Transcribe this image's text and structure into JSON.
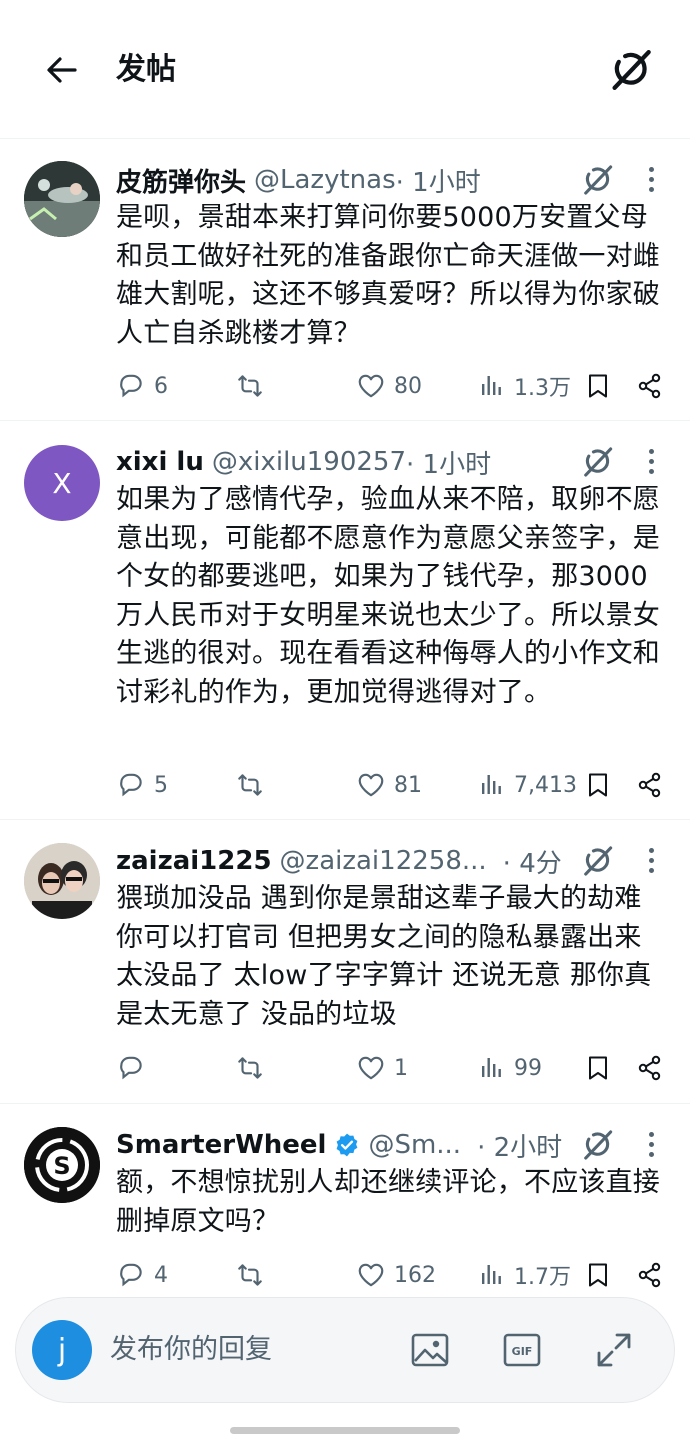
{
  "header": {
    "title": "发帖"
  },
  "icons": {
    "back": "arrow-left-icon",
    "grok": "grok-icon",
    "more": "more-dots-icon",
    "reply": "reply-icon",
    "repost": "repost-icon",
    "like": "heart-icon",
    "views": "views-bar-icon",
    "bookmark": "bookmark-icon",
    "share": "share-icon",
    "image": "image-icon",
    "gif": "gif-icon",
    "expand": "expand-icon",
    "verified": "verified-badge-icon"
  },
  "colors": {
    "text": "#0f1419",
    "secondary": "#536471",
    "accent": "#1d9bf0",
    "avatar_user": "#1d8ee0",
    "avatar_x": "#7e57c2"
  },
  "posts": [
    {
      "name": "皮筋弹你头",
      "handle": "@Lazytnas",
      "time": "· 1小时",
      "text": "是呗，景甜本来打算问你要5000万安置父母和员工做好社死的准备跟你亡命天涯做一对雌雄大割呢，这还不够真爱呀？所以得为你家破人亡自杀跳楼才算？",
      "replies": "6",
      "reposts": "",
      "likes": "80",
      "views": "1.3万"
    },
    {
      "name": "xixi lu",
      "handle": "@xixilu190257",
      "time": "· 1小时",
      "avatar_letter": "X",
      "text": "如果为了感情代孕，验血从来不陪，取卵不愿意出现，可能都不愿意作为意愿父亲签字，是个女的都要逃吧，如果为了钱代孕，那3000万人民币对于女明星来说也太少了。所以景女生逃的很对。现在看看这种侮辱人的小作文和讨彩礼的作为，更加觉得逃得对了。",
      "replies": "5",
      "reposts": "",
      "likes": "81",
      "views": "7,413"
    },
    {
      "name": "zaizai1225",
      "handle": "@zaizai12258...",
      "time": "· 4分",
      "text": "猥琐加没品 遇到你是景甜这辈子最大的劫难 你可以打官司 但把男女之间的隐私暴露出来 太没品了 太low了字字算计 还说无意 那你真是太无意了 没品的垃圾",
      "replies": "",
      "reposts": "",
      "likes": "1",
      "views": "99"
    },
    {
      "name": "SmarterWheel",
      "handle": "@Sm...",
      "time": "· 2小时",
      "text": "额，不想惊扰别人却还继续评论，不应该直接删掉原文吗？",
      "replies": "4",
      "reposts": "",
      "likes": "162",
      "views": "1.7万"
    }
  ],
  "composer": {
    "avatar_letter": "j",
    "placeholder": "发布你的回复"
  }
}
